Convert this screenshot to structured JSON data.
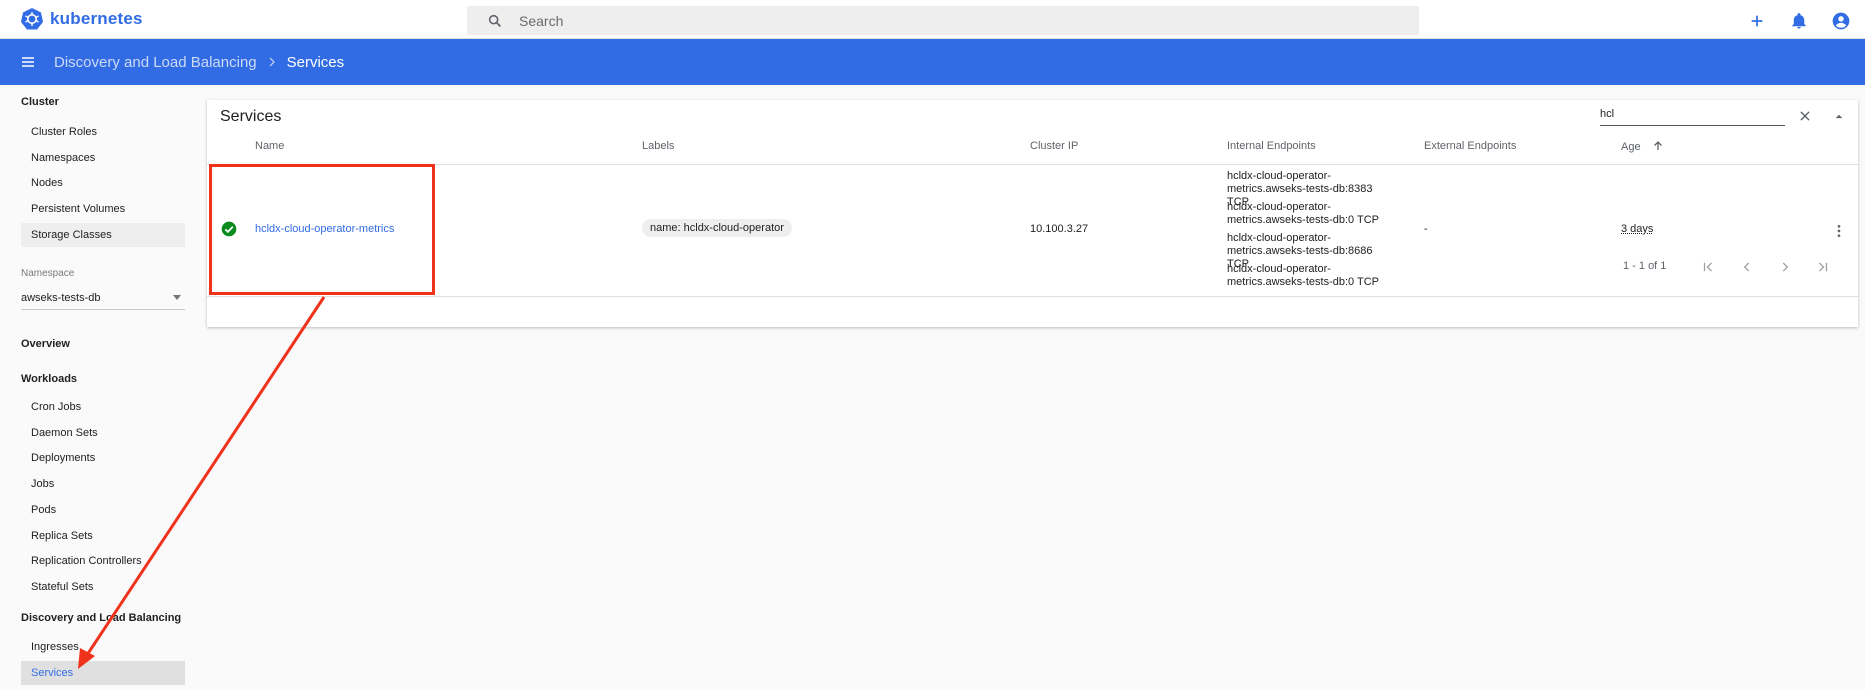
{
  "app": {
    "logo_text": "kubernetes"
  },
  "search": {
    "placeholder": "Search",
    "value": ""
  },
  "top_actions": [
    "add-icon",
    "notifications-icon",
    "account-icon"
  ],
  "header": {
    "breadcrumb": [
      {
        "label": "Discovery and Load Balancing"
      },
      {
        "label": "Services"
      }
    ]
  },
  "sidebar": {
    "cluster": {
      "title": "Cluster",
      "items": [
        "Cluster Roles",
        "Namespaces",
        "Nodes",
        "Persistent Volumes",
        "Storage Classes"
      ]
    },
    "namespace": {
      "label": "Namespace",
      "value": "awseks-tests-db"
    },
    "overview": "Overview",
    "workloads": {
      "title": "Workloads",
      "items": [
        "Cron Jobs",
        "Daemon Sets",
        "Deployments",
        "Jobs",
        "Pods",
        "Replica Sets",
        "Replication Controllers",
        "Stateful Sets"
      ]
    },
    "discovery": {
      "title": "Discovery and Load Balancing",
      "items": [
        "Ingresses",
        "Services"
      ]
    }
  },
  "card": {
    "title": "Services",
    "filter_value": "hcl",
    "columns": [
      "Name",
      "Labels",
      "Cluster IP",
      "Internal Endpoints",
      "External Endpoints",
      "Age"
    ],
    "rows": [
      {
        "status": "ok",
        "name": "hcldx-cloud-operator-metrics",
        "label": "name: hcldx-cloud-operator",
        "cluster_ip": "10.100.3.27",
        "internal_endpoints": [
          "hcldx-cloud-operator-metrics.awseks-tests-db:8383 TCP",
          "hcldx-cloud-operator-metrics.awseks-tests-db:0 TCP",
          "hcldx-cloud-operator-metrics.awseks-tests-db:8686 TCP",
          "hcldx-cloud-operator-metrics.awseks-tests-db:0 TCP"
        ],
        "external_endpoints": "-",
        "age": "3 days"
      }
    ],
    "pagination": "1 - 1 of 1"
  },
  "colors": {
    "brand": "#326ce5",
    "annotation": "#f0321c",
    "status_ok": "#0a8a1f"
  }
}
